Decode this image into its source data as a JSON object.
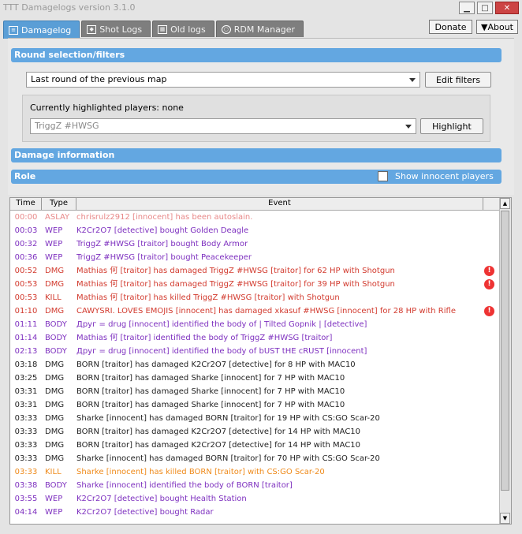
{
  "window": {
    "title": "TTT Damagelogs version 3.1.0"
  },
  "tabs": [
    {
      "label": "Damagelog",
      "icon": "list-icon"
    },
    {
      "label": "Shot Logs",
      "icon": "tag-icon"
    },
    {
      "label": "Old logs",
      "icon": "calendar-icon"
    },
    {
      "label": "RDM Manager",
      "icon": "magnifier-icon"
    }
  ],
  "top_buttons": {
    "donate": "Donate",
    "about": "▼About"
  },
  "sections": {
    "round": "Round selection/filters",
    "damage": "Damage information",
    "role": "Role"
  },
  "round_select": {
    "value": "Last round of the previous map"
  },
  "edit_filters": "Edit filters",
  "highlight": {
    "label": "Currently highlighted players: none",
    "player": "TriggZ #HWSG",
    "button": "Highlight"
  },
  "role_option": {
    "label": "Show innocent players"
  },
  "columns": {
    "time": "Time",
    "type": "Type",
    "event": "Event"
  },
  "colors": {
    "red": "#e0473f",
    "dmgred": "#d23a2e",
    "purple": "#7d2fbf",
    "blue": "#3a3ad2",
    "orange": "#ef8a1a",
    "black": "#222222",
    "pink": "#e88888"
  },
  "rows": [
    {
      "time": "00:00",
      "type": "ASLAY",
      "event": "chrisrulz2912 [innocent] has been autoslain.",
      "color": "#e88888",
      "warn": false
    },
    {
      "time": "00:03",
      "type": "WEP",
      "event": "K2Cr2O7 [detective] bought Golden Deagle",
      "color": "#7d2fbf",
      "warn": false
    },
    {
      "time": "00:32",
      "type": "WEP",
      "event": "TriggZ #HWSG [traitor] bought Body Armor",
      "color": "#7d2fbf",
      "warn": false
    },
    {
      "time": "00:36",
      "type": "WEP",
      "event": "TriggZ #HWSG [traitor] bought Peacekeeper",
      "color": "#7d2fbf",
      "warn": false
    },
    {
      "time": "00:52",
      "type": "DMG",
      "event": "Mathias 何 [traitor] has damaged TriggZ #HWSG [traitor] for 62 HP with Shotgun",
      "color": "#d23a2e",
      "warn": true
    },
    {
      "time": "00:53",
      "type": "DMG",
      "event": "Mathias 何 [traitor] has damaged TriggZ #HWSG [traitor] for 39 HP with Shotgun",
      "color": "#d23a2e",
      "warn": true
    },
    {
      "time": "00:53",
      "type": "KILL",
      "event": "Mathias 何 [traitor] has killed TriggZ #HWSG [traitor] with Shotgun",
      "color": "#d23a2e",
      "warn": false
    },
    {
      "time": "01:10",
      "type": "DMG",
      "event": "CAWYSRI. LOVES EMOJIS [innocent] has damaged xkasuf #HWSG [innocent] for 28 HP with Rifle",
      "color": "#d23a2e",
      "warn": true
    },
    {
      "time": "01:11",
      "type": "BODY",
      "event": "Друг = drug [innocent] identified the body of | Tilted Gopnik | [detective]",
      "color": "#7d2fbf",
      "warn": false
    },
    {
      "time": "01:14",
      "type": "BODY",
      "event": "Mathias 何 [traitor] identified the body of TriggZ #HWSG [traitor]",
      "color": "#7d2fbf",
      "warn": false
    },
    {
      "time": "02:13",
      "type": "BODY",
      "event": "Друг = drug [innocent] identified the body of bUST tHE cRUST [innocent]",
      "color": "#7d2fbf",
      "warn": false
    },
    {
      "time": "03:18",
      "type": "DMG",
      "event": "BORN [traitor] has damaged K2Cr2O7 [detective] for 8 HP with MAC10",
      "color": "#222222",
      "warn": false
    },
    {
      "time": "03:25",
      "type": "DMG",
      "event": "BORN [traitor] has damaged Sharke [innocent] for 7 HP with MAC10",
      "color": "#222222",
      "warn": false
    },
    {
      "time": "03:31",
      "type": "DMG",
      "event": "BORN [traitor] has damaged Sharke [innocent] for 7 HP with MAC10",
      "color": "#222222",
      "warn": false
    },
    {
      "time": "03:31",
      "type": "DMG",
      "event": "BORN [traitor] has damaged Sharke [innocent] for 7 HP with MAC10",
      "color": "#222222",
      "warn": false
    },
    {
      "time": "03:33",
      "type": "DMG",
      "event": "Sharke [innocent] has damaged BORN [traitor] for 19 HP with CS:GO Scar-20",
      "color": "#222222",
      "warn": false
    },
    {
      "time": "03:33",
      "type": "DMG",
      "event": "BORN [traitor] has damaged K2Cr2O7 [detective] for 14 HP with MAC10",
      "color": "#222222",
      "warn": false
    },
    {
      "time": "03:33",
      "type": "DMG",
      "event": "BORN [traitor] has damaged K2Cr2O7 [detective] for 14 HP with MAC10",
      "color": "#222222",
      "warn": false
    },
    {
      "time": "03:33",
      "type": "DMG",
      "event": "Sharke [innocent] has damaged BORN [traitor] for 70 HP with CS:GO Scar-20",
      "color": "#222222",
      "warn": false
    },
    {
      "time": "03:33",
      "type": "KILL",
      "event": "Sharke [innocent] has killed BORN [traitor] with CS:GO Scar-20",
      "color": "#ef8a1a",
      "warn": false
    },
    {
      "time": "03:38",
      "type": "BODY",
      "event": "Sharke [innocent] identified the body of BORN [traitor]",
      "color": "#7d2fbf",
      "warn": false
    },
    {
      "time": "03:55",
      "type": "WEP",
      "event": "K2Cr2O7 [detective] bought Health Station",
      "color": "#7d2fbf",
      "warn": false
    },
    {
      "time": "04:14",
      "type": "WEP",
      "event": "K2Cr2O7 [detective] bought Radar",
      "color": "#7d2fbf",
      "warn": false
    }
  ]
}
